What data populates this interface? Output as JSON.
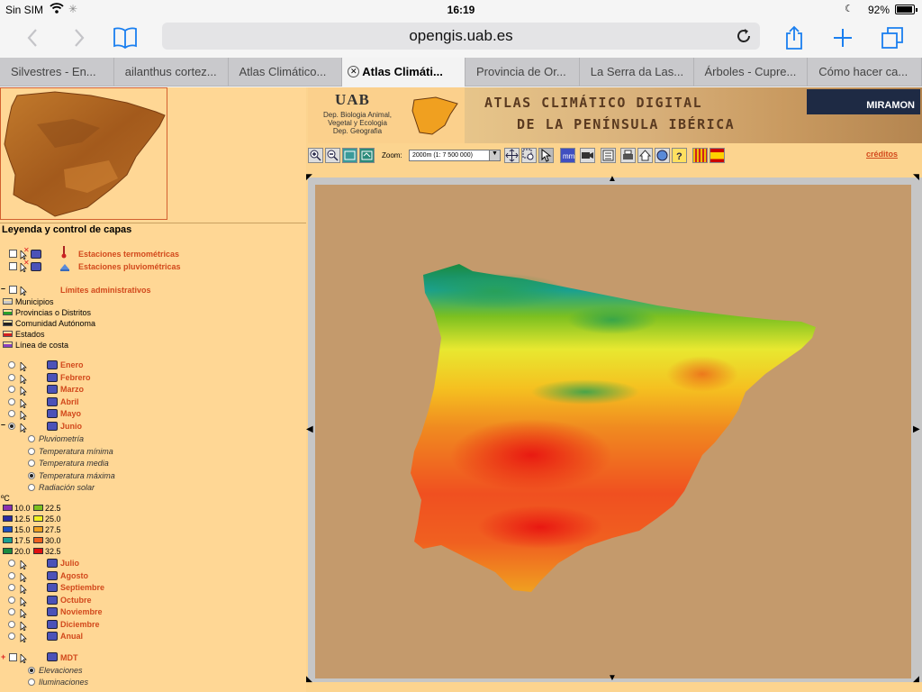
{
  "status": {
    "carrier": "Sin SIM",
    "time": "16:19",
    "battery_pct": "92%",
    "battery_level": 0.92
  },
  "browser": {
    "url": "opengis.uab.es",
    "tabs": [
      {
        "label": "Silvestres - En...",
        "active": false
      },
      {
        "label": "ailanthus cortez...",
        "active": false
      },
      {
        "label": "Atlas Climático...",
        "active": false
      },
      {
        "label": "Atlas Climáti...",
        "active": true
      },
      {
        "label": "Provincia de Or...",
        "active": false
      },
      {
        "label": "La Serra da Las...",
        "active": false
      },
      {
        "label": "Árboles - Cupre...",
        "active": false
      },
      {
        "label": "Cómo hacer ca...",
        "active": false
      }
    ]
  },
  "header": {
    "logo": "UAB",
    "dept_lines": [
      "Dep. Biologia Animal,",
      "Vegetal y Ecologia",
      "Dep. Geografia"
    ],
    "title_line1": "ATLAS CLIMÁTICO DIGITAL",
    "title_line2": "DE LA PENÍNSULA IBÉRICA",
    "miramon": "MIRAMON"
  },
  "toolbar": {
    "zoom_label": "Zoom:",
    "zoom_value": "2000m (1: 7 500 000)",
    "credits": "créditos"
  },
  "legend": {
    "title": "Leyenda y control de capas",
    "stations": [
      "Estaciones termométricas",
      "Estaciones pluviométricas"
    ],
    "admin_title": "Límites administrativos",
    "admin_items": [
      "Municipios",
      "Provincias o Distritos",
      "Comunidad Autónoma",
      "Estados",
      "Línea de costa"
    ],
    "months_a": [
      "Enero",
      "Febrero",
      "Marzo",
      "Abril",
      "Mayo",
      "Junio"
    ],
    "variables": [
      "Pluviometría",
      "Temperatura mínima",
      "Temperatura media",
      "Temperatura máxima",
      "Radiación solar"
    ],
    "selected_variable": "Temperatura máxima",
    "unit": "ºC",
    "scale_left": [
      "10.0",
      "12.5",
      "15.0",
      "17.5",
      "20.0"
    ],
    "scale_right": [
      "22.5",
      "25.0",
      "27.5",
      "30.0",
      "32.5"
    ],
    "scale_left_colors": [
      "#8a2fb0",
      "#2a2aa0",
      "#2050c0",
      "#1aa090",
      "#1a8a40"
    ],
    "scale_right_colors": [
      "#7cc020",
      "#f0f020",
      "#f0a020",
      "#f06020",
      "#e01010"
    ],
    "months_b": [
      "Julio",
      "Agosto",
      "Septiembre",
      "Octubre",
      "Noviembre",
      "Diciembre",
      "Anual"
    ],
    "mdt": "MDT",
    "mdt_options": [
      "Elevaciones",
      "Iluminaciones"
    ],
    "admin_colors": [
      "#c8c8c8",
      "#2aa02a",
      "#222222",
      "#d22020",
      "#8a40c0"
    ]
  }
}
